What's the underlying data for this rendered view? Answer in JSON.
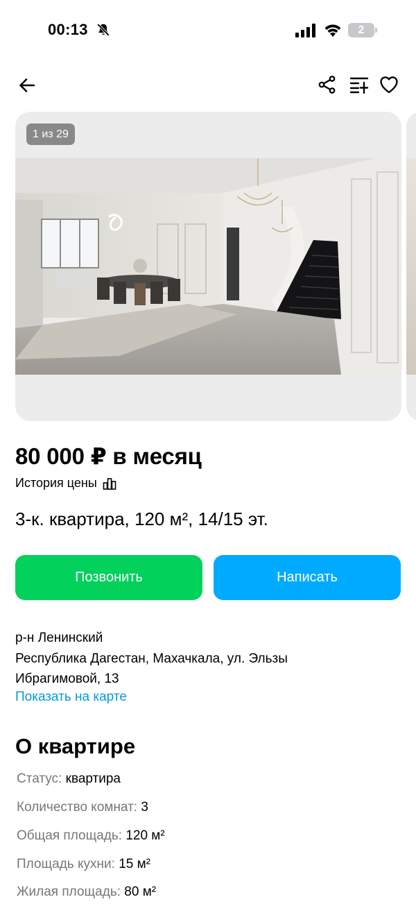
{
  "status_bar": {
    "time": "00:13",
    "battery": "2"
  },
  "gallery": {
    "counter": "1 из 29"
  },
  "listing": {
    "price": "80 000 ₽ в месяц",
    "price_history": "История цены",
    "title": "3-к. квартира, 120 м², 14/15 эт."
  },
  "actions": {
    "call": "Позвонить",
    "message": "Написать"
  },
  "address": {
    "district": "р-н Ленинский",
    "line1": "Республика Дагестан, Махачкала, ул. Эльзы",
    "line2": "Ибрагимовой, 13",
    "map_link": "Показать на карте"
  },
  "about": {
    "title": "О квартире",
    "params": [
      {
        "key": "Статус:",
        "value": "квартира"
      },
      {
        "key": "Количество комнат:",
        "value": "3"
      },
      {
        "key": "Общая площадь:",
        "value": "120 м²"
      },
      {
        "key": "Площадь кухни:",
        "value": "15 м²"
      },
      {
        "key": "Жилая площадь:",
        "value": "80 м²"
      }
    ]
  },
  "colors": {
    "call_button": "#02d15c",
    "message_button": "#00aaff",
    "link": "#0599e0"
  },
  "icons": [
    "bell-off-icon",
    "signal-icon",
    "wifi-icon",
    "battery-icon",
    "back-arrow-icon",
    "share-icon",
    "compare-icon",
    "heart-icon",
    "bar-chart-icon"
  ]
}
